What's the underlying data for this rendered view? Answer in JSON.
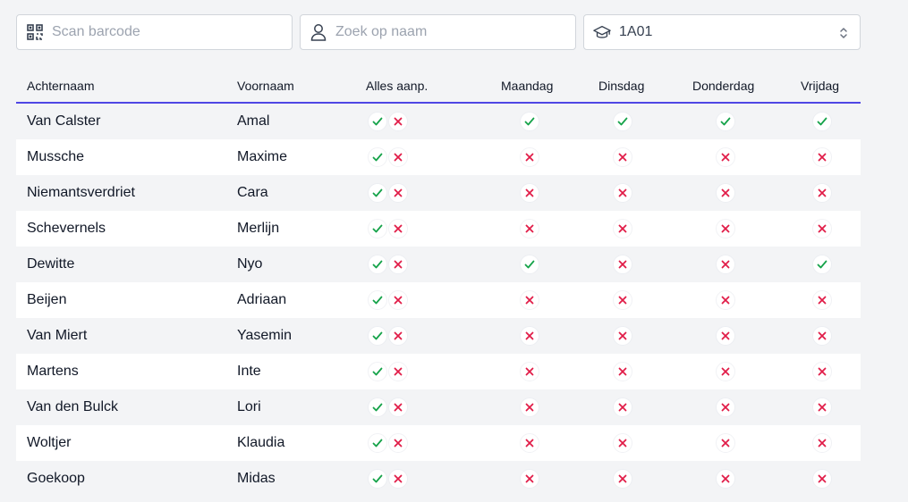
{
  "filters": {
    "barcode_placeholder": "Scan barcode",
    "name_placeholder": "Zoek op naam",
    "class_value": "1A01"
  },
  "columns": [
    "Achternaam",
    "Voornaam",
    "Alles aanp.",
    "Maandag",
    "Dinsdag",
    "Donderdag",
    "Vrijdag"
  ],
  "colors": {
    "check": "#16a34a",
    "cross": "#e11d48",
    "accent": "#4f46e5"
  },
  "students": [
    {
      "achternaam": "Van Calster",
      "voornaam": "Amal",
      "days": [
        true,
        true,
        true,
        true
      ]
    },
    {
      "achternaam": "Mussche",
      "voornaam": "Maxime",
      "days": [
        false,
        false,
        false,
        false
      ]
    },
    {
      "achternaam": "Niemantsverdriet",
      "voornaam": "Cara",
      "days": [
        false,
        false,
        false,
        false
      ]
    },
    {
      "achternaam": "Schevernels",
      "voornaam": "Merlijn",
      "days": [
        false,
        false,
        false,
        false
      ]
    },
    {
      "achternaam": "Dewitte",
      "voornaam": "Nyo",
      "days": [
        true,
        false,
        false,
        true
      ]
    },
    {
      "achternaam": "Beijen",
      "voornaam": "Adriaan",
      "days": [
        false,
        false,
        false,
        false
      ]
    },
    {
      "achternaam": "Van Miert",
      "voornaam": "Yasemin",
      "days": [
        false,
        false,
        false,
        false
      ]
    },
    {
      "achternaam": "Martens",
      "voornaam": "Inte",
      "days": [
        false,
        false,
        false,
        false
      ]
    },
    {
      "achternaam": "Van den Bulck",
      "voornaam": "Lori",
      "days": [
        false,
        false,
        false,
        false
      ]
    },
    {
      "achternaam": "Woltjer",
      "voornaam": "Klaudia",
      "days": [
        false,
        false,
        false,
        false
      ]
    },
    {
      "achternaam": "Goekoop",
      "voornaam": "Midas",
      "days": [
        false,
        false,
        false,
        false
      ]
    }
  ]
}
